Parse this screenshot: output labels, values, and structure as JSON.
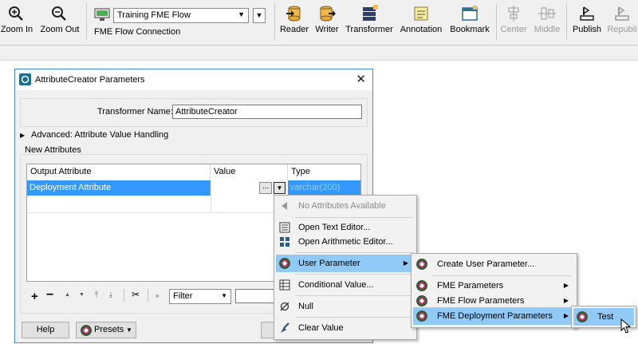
{
  "toolbar": {
    "zoom_in": "Zoom In",
    "zoom_out": "Zoom Out",
    "connection_value": "Training FME Flow",
    "connection_label": "FME Flow Connection",
    "reader": "Reader",
    "writer": "Writer",
    "transformer": "Transformer",
    "annotation": "Annotation",
    "bookmark": "Bookmark",
    "center": "Center",
    "middle": "Middle",
    "publish": "Publish",
    "republish": "Republi"
  },
  "dialog": {
    "title": "AttributeCreator Parameters",
    "transformer_name_label": "Transformer Name:",
    "transformer_name_value": "AttributeCreator",
    "advanced_label": "Advanced: Attribute Value Handling",
    "new_attributes_label": "New Attributes",
    "table": {
      "columns": [
        "Output Attribute",
        "Value",
        "Type"
      ],
      "rows": [
        {
          "output": "Deployment Attribute",
          "value": "",
          "type": "varchar(200)"
        }
      ],
      "ellipsis": "..."
    },
    "filter_label": "Filter",
    "help_button": "Help",
    "presets_button": "Presets"
  },
  "menu1": {
    "items": [
      {
        "label": "No Attributes Available",
        "icon": "arrow-left-icon",
        "disabled": true
      },
      {
        "label": "Open Text Editor...",
        "icon": "text-editor-icon"
      },
      {
        "label": "Open Arithmetic Editor...",
        "icon": "calculator-icon"
      },
      {
        "label": "User Parameter",
        "icon": "gear-icon",
        "highlight": true,
        "submenu": true
      },
      {
        "label": "Conditional Value...",
        "icon": "table-icon"
      },
      {
        "label": "Null",
        "icon": "null-icon"
      },
      {
        "label": "Clear Value",
        "icon": "broom-icon"
      }
    ]
  },
  "menu2": {
    "items": [
      {
        "label": "Create User Parameter...",
        "icon": "gear-icon"
      },
      {
        "label": "FME Parameters",
        "icon": "gear-icon",
        "submenu": true
      },
      {
        "label": "FME Flow Parameters",
        "icon": "gear-icon",
        "submenu": true
      },
      {
        "label": "FME Deployment Parameters",
        "icon": "gear-icon",
        "submenu": true,
        "highlight": true
      }
    ]
  },
  "menu3": {
    "items": [
      {
        "label": "Test",
        "icon": "gear-icon",
        "highlight": true
      }
    ]
  },
  "colors": {
    "selection": "#3399ff",
    "menu_highlight": "#91c9f7",
    "dialog_border": "#3b8ed0"
  }
}
